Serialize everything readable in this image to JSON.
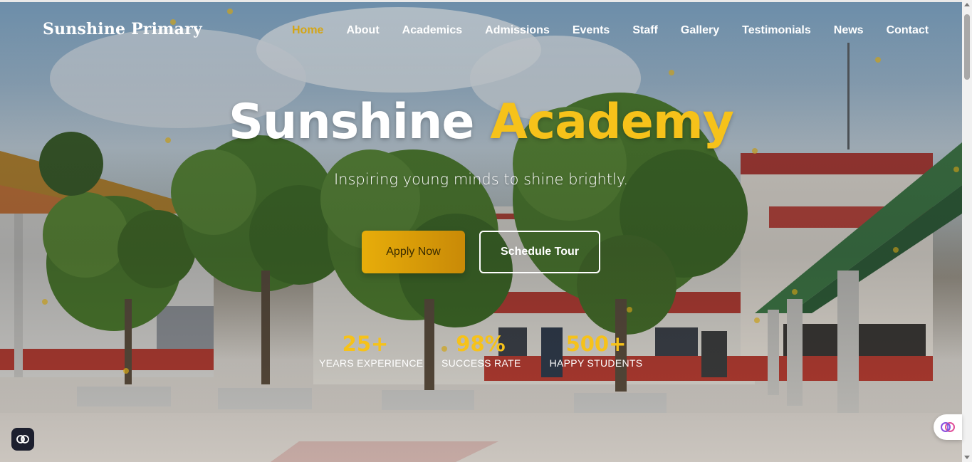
{
  "brand": {
    "name": "Sunshine Primary"
  },
  "nav": {
    "items": [
      {
        "label": "Home",
        "active": true
      },
      {
        "label": "About"
      },
      {
        "label": "Academics"
      },
      {
        "label": "Admissions"
      },
      {
        "label": "Events"
      },
      {
        "label": "Staff"
      },
      {
        "label": "Gallery"
      },
      {
        "label": "Testimonials"
      },
      {
        "label": "News"
      },
      {
        "label": "Contact"
      }
    ]
  },
  "hero": {
    "title_part1": "Sunshine",
    "title_part2": "Academy",
    "tagline": "Inspiring young minds to shine brightly.",
    "primary_cta": "Apply Now",
    "secondary_cta": "Schedule Tour",
    "stats": [
      {
        "value": "25+",
        "label": "YEARS EXPERIENCE"
      },
      {
        "value": "98%",
        "label": "SUCCESS RATE"
      },
      {
        "value": "500+",
        "label": "HAPPY STUDENTS"
      }
    ]
  },
  "colors": {
    "accent": "#f6c21a",
    "nav_active": "#d4a516",
    "button_gradient_start": "#e7ad0a",
    "button_gradient_end": "#c98a07"
  },
  "icons": {
    "left_widget": "brain-icon",
    "right_widget": "brain-icon"
  }
}
